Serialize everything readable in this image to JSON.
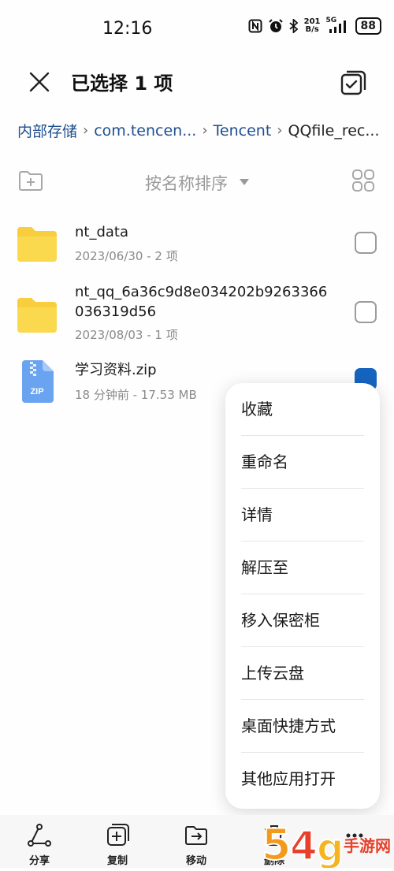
{
  "status": {
    "time": "12:16",
    "netspeed_value": "201",
    "netspeed_unit": "B/s",
    "network": "5G",
    "battery": "88"
  },
  "header": {
    "title": "已选择 1 项"
  },
  "breadcrumb": [
    "内部存储",
    "com.tencen...",
    "Tencent",
    "QQfile_rec..."
  ],
  "sort": {
    "label": "按名称排序"
  },
  "files": [
    {
      "name": "nt_data",
      "meta": "2023/06/30 - 2 项",
      "type": "folder-icon",
      "checked": false
    },
    {
      "name": "nt_qq_6a36c9d8e034202b9263366036319d56",
      "meta": "2023/08/03 - 1 项",
      "type": "folder-icon",
      "checked": false
    },
    {
      "name": "学习资料.zip",
      "meta": "18 分钟前 - 17.53 MB",
      "type": "zip-file-icon",
      "icon_text": "ZIP",
      "checked": true
    }
  ],
  "menu": [
    "收藏",
    "重命名",
    "详情",
    "解压至",
    "移入保密柜",
    "上传云盘",
    "桌面快捷方式",
    "其他应用打开"
  ],
  "bottom": [
    "分享",
    "复制",
    "移动",
    "删除"
  ],
  "watermark": {
    "text": "手游网"
  },
  "colors": {
    "accent": "#1565c0",
    "folder": "#f8ce3f",
    "zip": "#6aa3f0",
    "breadcrumb": "#1f4f8f"
  }
}
